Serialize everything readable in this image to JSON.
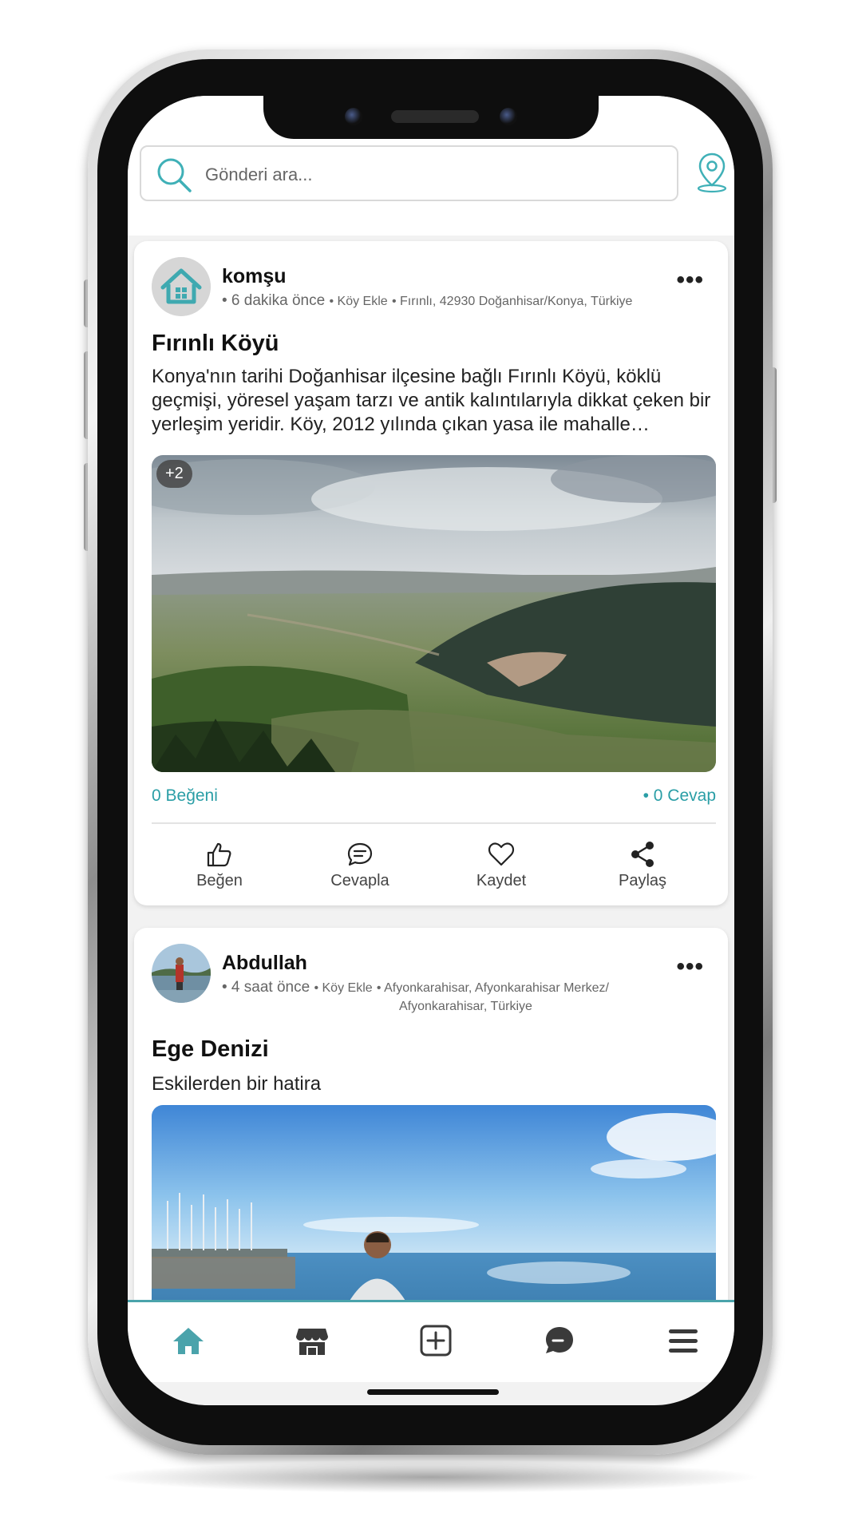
{
  "search": {
    "placeholder": "Gönderi ara..."
  },
  "colors": {
    "accent": "#2a9ea6",
    "nav_active": "#4aa3ab",
    "nav_inactive": "#3a3a3a"
  },
  "posts": [
    {
      "author": "komşu",
      "time": "• 6 dakika önce",
      "tag": "• Köy Ekle",
      "location": "• Fırınlı, 42930 Doğanhisar/Konya, Türkiye",
      "title": "Fırınlı Köyü",
      "text": "Konya'nın tarihi Doğanhisar ilçesine bağlı Fırınlı Köyü, köklü geçmişi, yöresel yaşam tarzı ve antik kalıntılarıyla dikkat çeken bir yerleşim yeridir. Köy, 2012 yılında çıkan yasa ile mahalle statüsüne geçmiştir.",
      "extra_photos": "+2",
      "likes": "0 Beğeni",
      "replies": "• 0 Cevap",
      "actions": {
        "like": "Beğen",
        "reply": "Cevapla",
        "save": "Kaydet",
        "share": "Paylaş"
      }
    },
    {
      "author": "Abdullah",
      "time": "• 4 saat önce",
      "tag": "• Köy Ekle",
      "location_line1": "• Afyonkarahisar, Afyonkarahisar Merkez/",
      "location_line2": "Afyonkarahisar, Türkiye",
      "title": "Ege Denizi",
      "text": "Eskilerden bir hatira"
    }
  ],
  "nav": [
    {
      "name": "home-icon",
      "active": true
    },
    {
      "name": "store-icon",
      "active": false
    },
    {
      "name": "add-icon",
      "active": false
    },
    {
      "name": "messages-icon",
      "active": false
    },
    {
      "name": "menu-icon",
      "active": false
    }
  ]
}
